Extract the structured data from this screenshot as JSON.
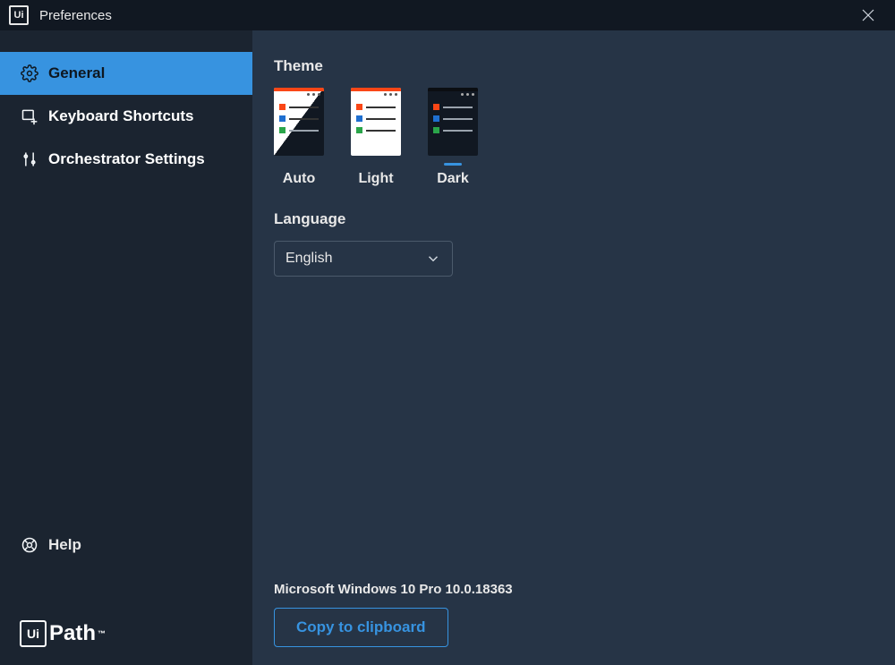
{
  "window": {
    "title": "Preferences",
    "app_icon_text": "Ui"
  },
  "sidebar": {
    "items": [
      {
        "label": "General",
        "icon": "gear-icon",
        "selected": true
      },
      {
        "label": "Keyboard Shortcuts",
        "icon": "keyboard-shortcut-icon",
        "selected": false
      },
      {
        "label": "Orchestrator Settings",
        "icon": "sliders-icon",
        "selected": false
      }
    ],
    "help_label": "Help",
    "brand": {
      "box": "Ui",
      "text": "Path",
      "tm": "™"
    }
  },
  "main": {
    "theme": {
      "heading": "Theme",
      "options": [
        {
          "label": "Auto",
          "kind": "auto",
          "selected": false
        },
        {
          "label": "Light",
          "kind": "light",
          "selected": false
        },
        {
          "label": "Dark",
          "kind": "dark",
          "selected": true
        }
      ]
    },
    "language": {
      "heading": "Language",
      "selected": "English"
    },
    "os_info": "Microsoft Windows 10 Pro 10.0.18363",
    "copy_button": "Copy to clipboard"
  },
  "colors": {
    "accent": "#3793e0"
  }
}
